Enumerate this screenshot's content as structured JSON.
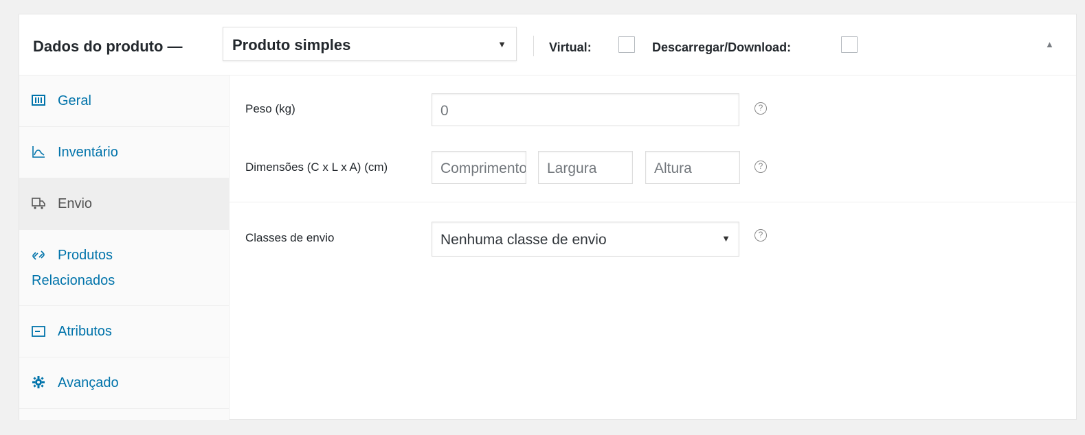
{
  "header": {
    "title": "Dados do produto —",
    "product_type": "Produto simples",
    "virtual_label": "Virtual:",
    "download_label": "Descarregar/Download:",
    "virtual_checked": false,
    "download_checked": false
  },
  "tabs": [
    {
      "label": "Geral",
      "icon": "grid-icon",
      "active": false
    },
    {
      "label": "Inventário",
      "icon": "chart-icon",
      "active": false
    },
    {
      "label": "Envio",
      "icon": "truck-icon",
      "active": true
    },
    {
      "label_line1": "Produtos",
      "label_line2": "Relacionados",
      "icon": "link-icon",
      "active": false
    },
    {
      "label": "Atributos",
      "icon": "attributes-icon",
      "active": false
    },
    {
      "label": "Avançado",
      "icon": "gear-icon",
      "active": false
    }
  ],
  "shipping": {
    "weight_label": "Peso (kg)",
    "weight_placeholder": "0",
    "dimensions_label": "Dimensões (C x L x A) (cm)",
    "length_placeholder": "Comprimento",
    "width_placeholder": "Largura",
    "height_placeholder": "Altura",
    "class_label": "Classes de envio",
    "class_value": "Nenhuma classe de envio"
  },
  "colors": {
    "link": "#0073aa",
    "active_tab_bg": "#eeeeee",
    "border": "#dddddd"
  }
}
